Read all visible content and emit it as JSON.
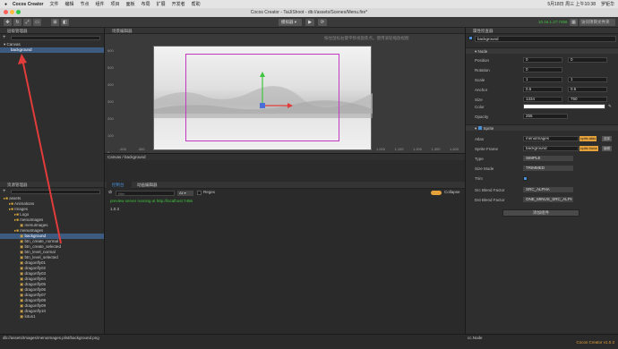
{
  "menubar": {
    "app": "Cocos Creator",
    "items": [
      "文件",
      "编辑",
      "节点",
      "组件",
      "项目",
      "面板",
      "布局",
      "扩展",
      "开发者",
      "帮助"
    ],
    "right": [
      "5月18日 周三 上午10:38",
      "罗钜华"
    ]
  },
  "window_title": "Cocos Creator - TaiJiShoot - db://assets/Scenes/Menu.fire*",
  "toolbar": {
    "platform": "模拟器",
    "ip": "10.16.1.27:7456",
    "open_project": "访问项目文件夹",
    "play_icon": "play-icon"
  },
  "hierarchy": {
    "title": "层级管理器",
    "root": "Canvas",
    "child": "background"
  },
  "assets": {
    "title": "资源管理器",
    "items": [
      "assets",
      "Animations",
      "Images",
      "Logo",
      "menuImages",
      "menuImages",
      "menuImages",
      "background",
      "btn_create_normal",
      "btn_create_selected",
      "btn_level_normal",
      "btn_level_selected",
      "dragonfly01",
      "dragonfly02",
      "dragonfly03",
      "dragonfly04",
      "dragonfly05",
      "dragonfly06",
      "dragonfly07",
      "dragonfly08",
      "dragonfly09",
      "dragonfly10",
      "lotus1"
    ]
  },
  "scene": {
    "title": "场景编辑器",
    "hint": "按住鼠标右键平移视窗焦点。使用滚轮缩放视图",
    "y_ticks": [
      "600",
      "500",
      "400",
      "300",
      "200",
      "100",
      "0"
    ],
    "x_ticks": [
      "-400",
      "-300",
      "-200",
      "-100",
      "0",
      "100",
      "200",
      "300",
      "400",
      "500",
      "600",
      "700",
      "800",
      "900",
      "1,000",
      "1,100",
      "1,200",
      "1,300",
      "1,400"
    ]
  },
  "breadcrumb": "Canvas / background",
  "console": {
    "tabs": [
      "控制台",
      "动画编辑器"
    ],
    "filter_placeholder": "filter",
    "level": "All",
    "regex": "Regex",
    "collapse": "Collapse",
    "log1": "preview server running at http://localhost:7456",
    "log2": "1.0.3"
  },
  "inspector": {
    "title": "属性检查器",
    "node_name": "background",
    "node_section": "Node",
    "props": [
      {
        "label": "Position",
        "v1": "0",
        "v2": "0"
      },
      {
        "label": "Rotation",
        "v1": "0",
        "v2": ""
      },
      {
        "label": "Scale",
        "v1": "1",
        "v2": "1"
      },
      {
        "label": "Anchor",
        "v1": "0.5",
        "v2": "0.5"
      },
      {
        "label": "Size",
        "v1": "1334",
        "v2": "750"
      }
    ],
    "color_label": "Color",
    "opacity_label": "Opacity",
    "opacity": "255",
    "sprite_section": "Sprite",
    "atlas_label": "Atlas",
    "atlas": "menuImages",
    "frame_label": "Sprite Frame",
    "frame": "background",
    "type_label": "Type",
    "type": "SIMPLE",
    "sizemode_label": "Size Mode",
    "sizemode": "TRIMMED",
    "trim_label": "Trim",
    "src_label": "Src Blend Factor",
    "src": "SRC_ALPHA",
    "dst_label": "Dst Blend Factor",
    "dst": "ONE_MINUS_SRC_ALPHA",
    "add_component": "添加组件",
    "select": "选择",
    "edit": "编辑",
    "sprite_atlas_tag": "sprite-atlas",
    "sprite_frame_tag": "sprite-frame"
  },
  "status": {
    "path": "db://assets/Images/menuImages.plist/background.png",
    "node": "cc.Node",
    "version": "Cocos Creator v1.0.3"
  },
  "colors": {
    "accent": "#4a90d9",
    "arrow": "#e23b3b",
    "log_green": "#3ec43e",
    "version_orange": "#e5a23a"
  }
}
